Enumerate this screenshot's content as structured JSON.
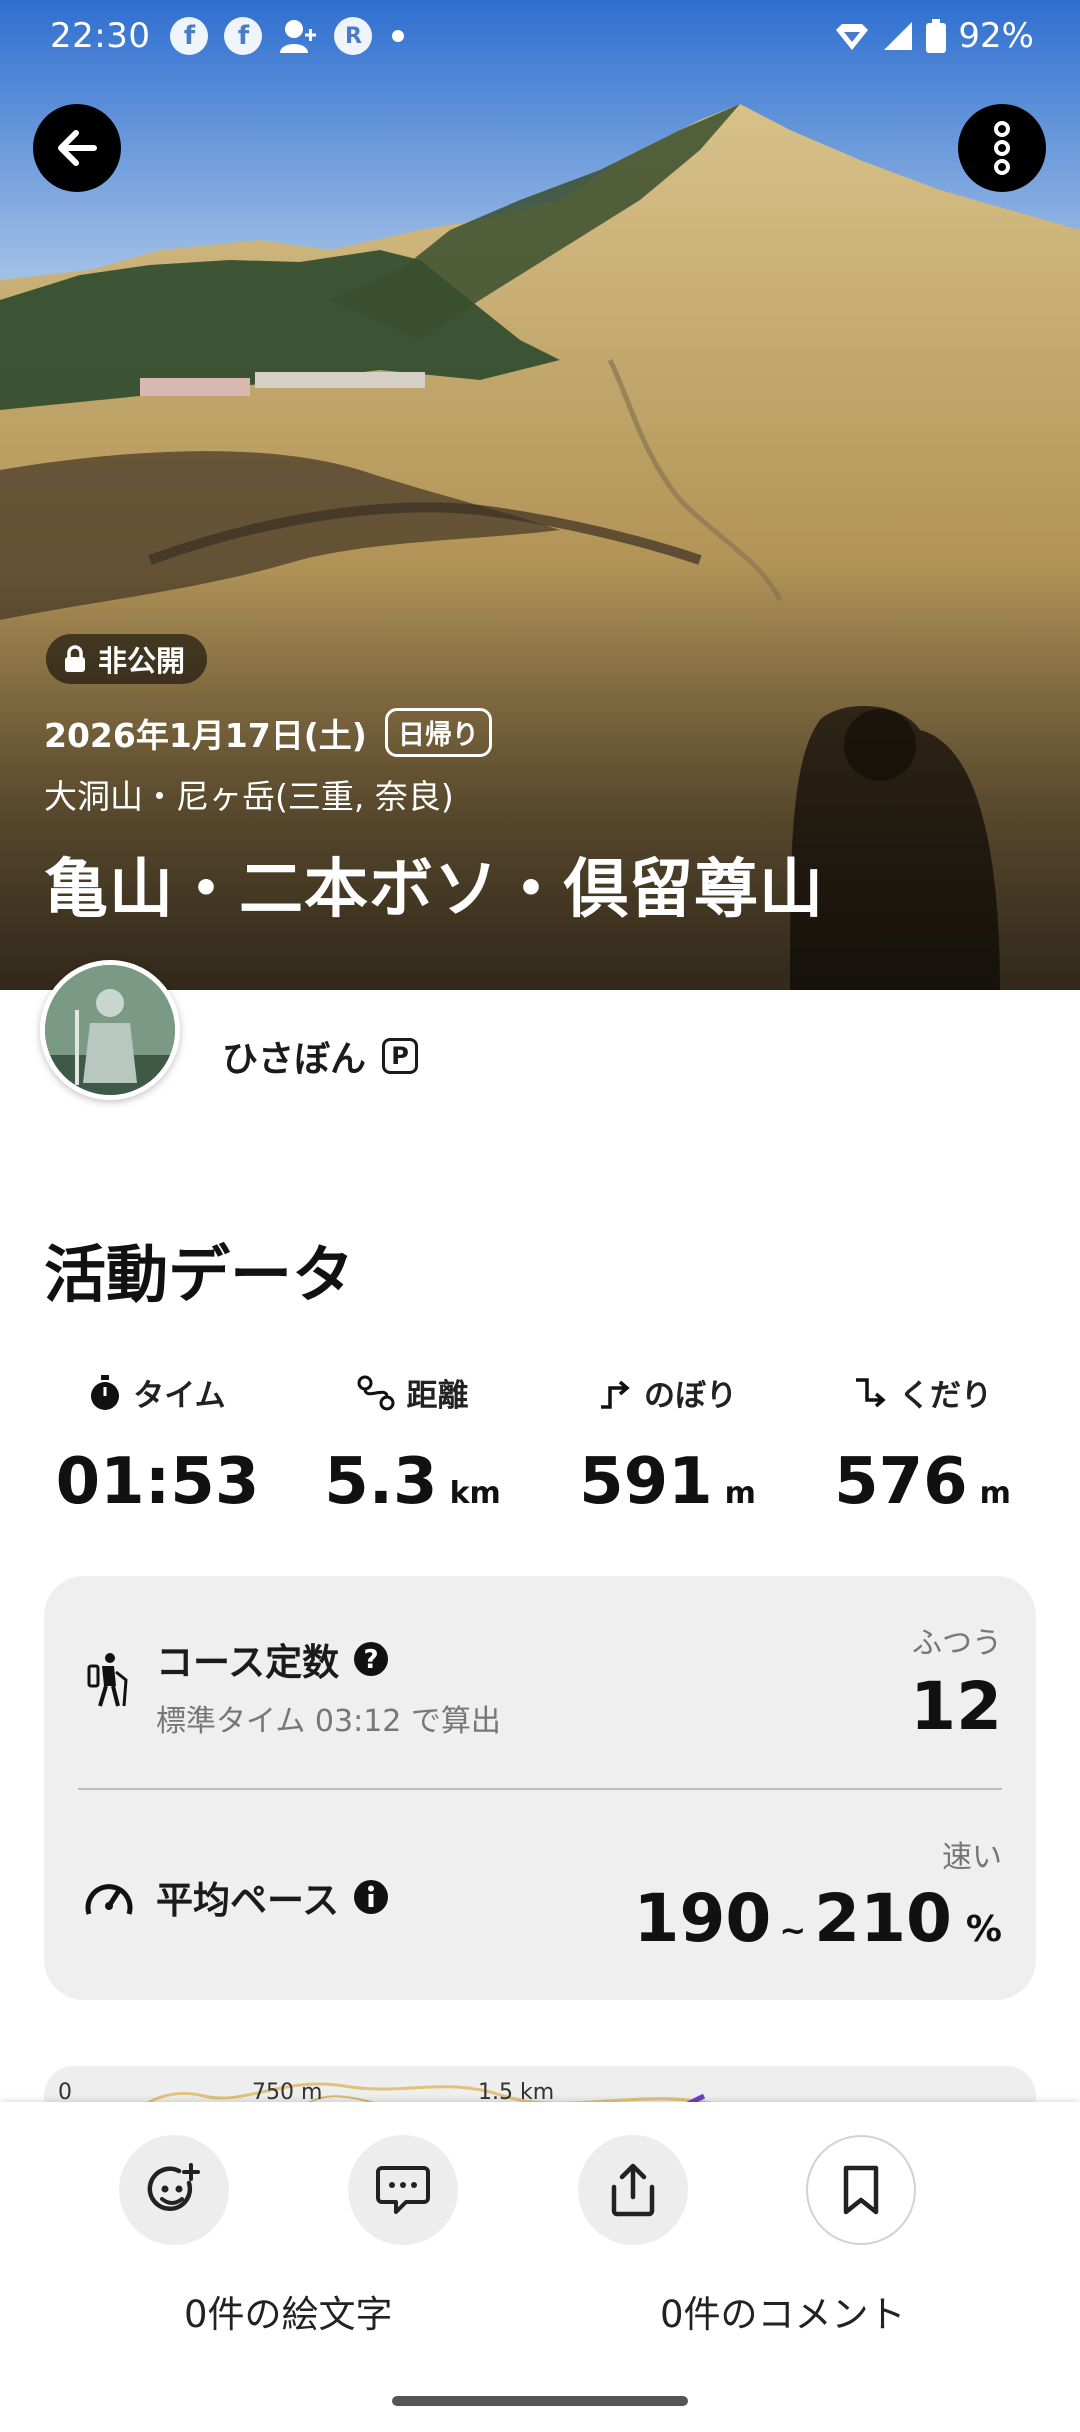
{
  "status_bar": {
    "time": "22:30",
    "icons": [
      "facebook-icon",
      "facebook-icon",
      "add-contact-icon",
      "r-app-icon",
      "dot-icon"
    ],
    "battery": "92%"
  },
  "hero": {
    "privacy_badge": "非公開",
    "date": "2026年1月17日(土)",
    "trip_type": "日帰り",
    "area": "大洞山・尼ヶ岳(三重, 奈良)",
    "title": "亀山・二本ボソ・倶留尊山"
  },
  "user": {
    "name": "ひさぼん",
    "badge": "P"
  },
  "activity": {
    "section_title": "活動データ",
    "stats": [
      {
        "label": "タイム",
        "value": "01:53",
        "unit": ""
      },
      {
        "label": "距離",
        "value": "5.3",
        "unit": "km"
      },
      {
        "label": "のぼり",
        "value": "591",
        "unit": "m"
      },
      {
        "label": "くだり",
        "value": "576",
        "unit": "m"
      }
    ]
  },
  "course_card": {
    "course_label": "コース定数",
    "course_sub": "標準タイム 03:12 で算出",
    "course_level": "ふつう",
    "course_value": "12",
    "pace_label": "平均ペース",
    "pace_level": "速い",
    "pace_min": "190",
    "pace_sep": "~",
    "pace_max": "210",
    "pace_unit": "%"
  },
  "map": {
    "scale_0": "0",
    "scale_1": "750 m",
    "scale_2": "1.5 km"
  },
  "actions": {
    "emoji_text": "0件の絵文字",
    "comment_text": "0件のコメント"
  },
  "colors": {
    "card_bg": "#efefef",
    "button_bg": "#000000"
  }
}
